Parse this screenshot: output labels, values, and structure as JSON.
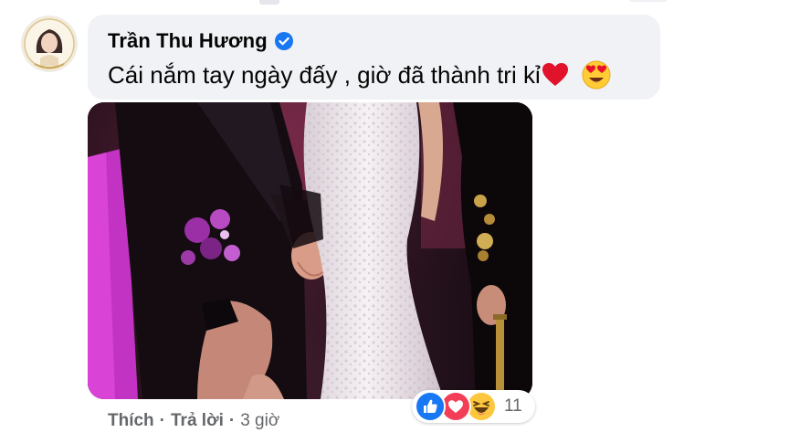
{
  "comment": {
    "author": "Trần Thu Hương",
    "verified_icon": "verified-badge-icon",
    "text": "Cái nắm tay ngày đấy , giờ đã thành tri kỉ",
    "inline_emojis": [
      "red-heart-emoji",
      "heart-eyes-emoji"
    ]
  },
  "attachment": {
    "type": "photo",
    "subject": "wedding-hands-photo"
  },
  "actions": {
    "like": "Thích",
    "separator": "·",
    "reply": "Trả lời",
    "time": "3 giờ"
  },
  "reactions": {
    "icons": [
      "like-reaction-icon",
      "love-reaction-icon",
      "haha-reaction-icon"
    ],
    "count": "11"
  },
  "colors": {
    "bubble_bg": "#f0f2f5",
    "meta_text": "#65676b",
    "like_blue": "#1877f2",
    "love_red": "#f33e58",
    "haha_yellow": "#fcc73f"
  }
}
